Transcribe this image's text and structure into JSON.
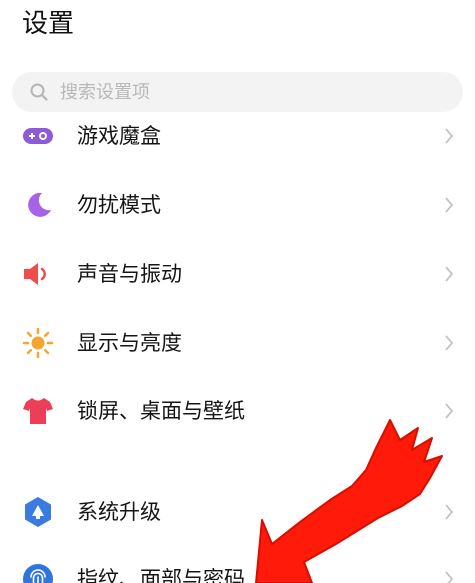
{
  "header": {
    "title": "设置"
  },
  "search": {
    "placeholder": "搜索设置项",
    "icon": "search-icon"
  },
  "settings": {
    "items": [
      {
        "label": "游戏魔盒",
        "icon": "game-box-icon",
        "color": "#8e5bd6"
      },
      {
        "label": "勿扰模式",
        "icon": "moon-icon",
        "color": "#a663e6"
      },
      {
        "label": "声音与振动",
        "icon": "speaker-icon",
        "color": "#ef4c4c"
      },
      {
        "label": "显示与亮度",
        "icon": "sun-icon",
        "color": "#f6a531"
      },
      {
        "label": "锁屏、桌面与壁纸",
        "icon": "tshirt-icon",
        "color": "#ec3e56"
      },
      {
        "label": "系统升级",
        "icon": "system-upgrade-icon",
        "color": "#3a7be2"
      },
      {
        "label": "指纹、面部与密码",
        "icon": "fingerprint-icon",
        "color": "#2f74e0"
      }
    ]
  },
  "overlay": {
    "arrow_color": "#ff1a0a"
  }
}
